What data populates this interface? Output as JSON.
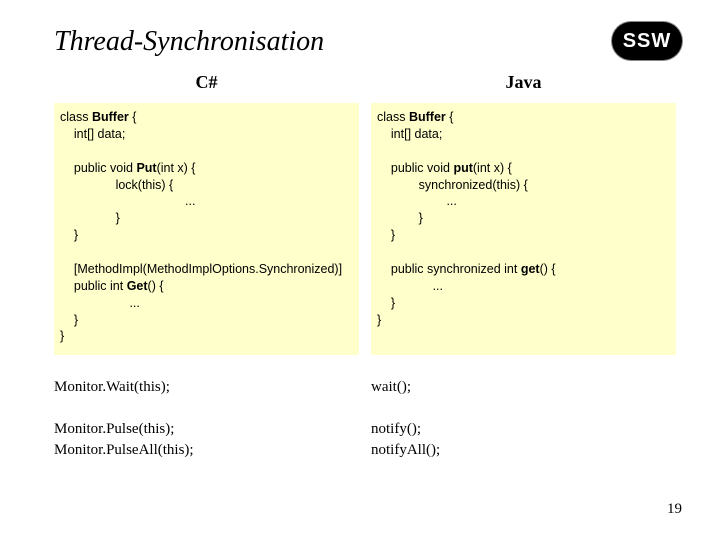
{
  "logo_text": "SSW",
  "title": "Thread-Synchronisation",
  "left": {
    "heading": "C#",
    "code_html": "class <b>Buffer</b> {\n    int[] data;\n\n    public void <b>Put</b>(int x) {\n                lock(this) {\n                                    ...\n                }\n    }\n\n    [MethodImpl(MethodImplOptions.Synchronized)]\n    public int <b>Get</b>() {\n                    ...\n    }\n}",
    "extras": "Monitor.Wait(this);\n\nMonitor.Pulse(this);\nMonitor.PulseAll(this);"
  },
  "right": {
    "heading": "Java",
    "code_html": "class <b>Buffer</b> {\n    int[] data;\n\n    public void <b>put</b>(int x) {\n            synchronized(this) {\n                    ...\n            }\n    }\n\n    public synchronized int <b>get</b>() {\n                ...\n    }\n}",
    "extras": "wait();\n\nnotify();\nnotifyAll();"
  },
  "page_number": "19"
}
